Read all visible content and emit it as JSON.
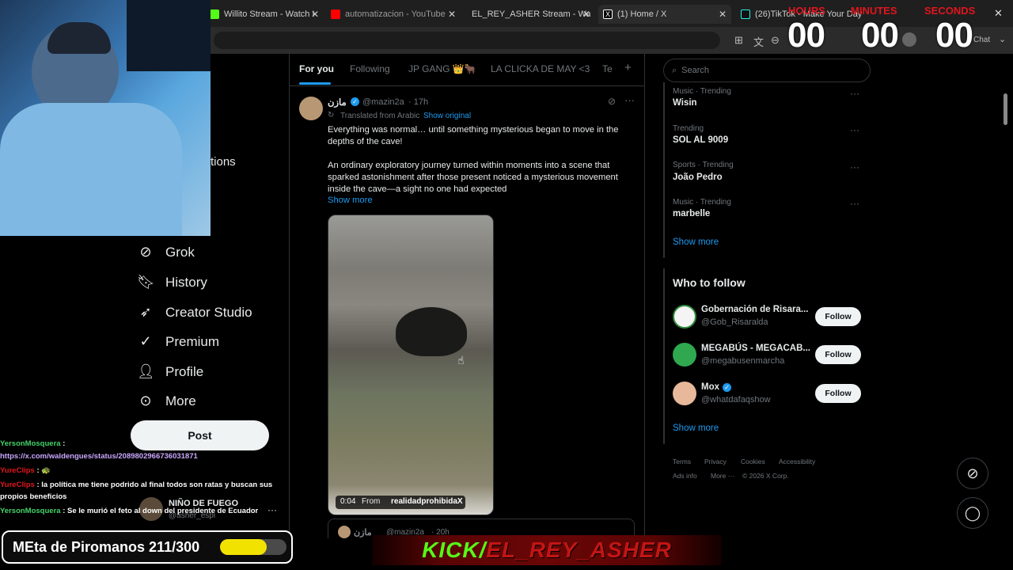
{
  "browser": {
    "tabs": [
      {
        "label": "Willito Stream - Watch I",
        "color": "#53fc18"
      },
      {
        "label": "automatizacion - YouTube",
        "color": "#ff0000"
      },
      {
        "label": "EL_REY_ASHER Stream - Watc",
        "color": "#53fc18"
      },
      {
        "label": "(1) Home / X",
        "color": "#ffffff"
      },
      {
        "label": "(26)TikTok - Make Your Day",
        "color": "#ffffff"
      }
    ],
    "chat_label": "Chat"
  },
  "timer": {
    "hours_label": "HOURS",
    "minutes_label": "MINUTES",
    "seconds_label": "SECONDS",
    "hours": "00",
    "minutes": "00",
    "seconds": "00"
  },
  "sidebar": {
    "partial_label": "tions",
    "items": [
      {
        "label": "Grok",
        "icon": "grok-icon"
      },
      {
        "label": "History",
        "icon": "bookmark-icon"
      },
      {
        "label": "Creator Studio",
        "icon": "rocket-icon"
      },
      {
        "label": "Premium",
        "icon": "verified-icon"
      },
      {
        "label": "Profile",
        "icon": "user-icon"
      },
      {
        "label": "More",
        "icon": "more-circle-icon"
      }
    ],
    "post_label": "Post",
    "account": {
      "name": "NIÑO DE FUEGO",
      "handle": "@asher_espi"
    }
  },
  "feed": {
    "tabs": [
      "For you",
      "Following",
      "JP GANG 👑🐂",
      "LA CLICKA DE MAY <3",
      "Te"
    ],
    "tweet": {
      "author": "مازن",
      "handle": "@mazin2a",
      "time": "· 17h",
      "translated": "Translated from Arabic",
      "show_original": "Show original",
      "para1": "Everything was normal… until something mysterious began to move in the depths of the cave!",
      "para2": "An ordinary exploratory journey turned within moments into a scene that sparked astonishment after those present noticed a mysterious movement inside the cave—a sight no one had expected",
      "show_more": "Show more",
      "video_time": "0:04",
      "video_from": "From",
      "video_source": "realidadprohibidaX"
    },
    "next_tweet": {
      "author": "مازن",
      "handle": "@mazin2a",
      "time": "· 20h"
    }
  },
  "right": {
    "search_placeholder": "Search",
    "trends": [
      {
        "category": "Music · Trending",
        "name": "Wisin"
      },
      {
        "category": "Trending",
        "name": "SOL AL 9009"
      },
      {
        "category": "Sports · Trending",
        "name": "João Pedro"
      },
      {
        "category": "Music · Trending",
        "name": "marbelle"
      }
    ],
    "show_more": "Show more",
    "who_to_follow_title": "Who to follow",
    "who_to_follow": [
      {
        "name": "Gobernación de Risara...",
        "handle": "@Gob_Risaralda",
        "button": "Follow"
      },
      {
        "name": "MEGABÚS - MEGACAB...",
        "handle": "@megabusenmarcha",
        "button": "Follow"
      },
      {
        "name": "Mox",
        "handle": "@whatdafaqshow",
        "button": "Follow"
      }
    ],
    "footer_row1": [
      "Terms",
      "Privacy",
      "Cookies",
      "Accessibility"
    ],
    "footer_row2": [
      "Ads info",
      "More ···",
      "© 2026 X Corp."
    ]
  },
  "chat": [
    {
      "user": "YersonMosquera",
      "text": ":"
    },
    {
      "user": "",
      "text": "https://x.com/waldengues/status/2089802966736031871"
    },
    {
      "user": "YureClips",
      "text": ": 🐢"
    },
    {
      "user": "YureClips",
      "text": ": la política me tiene podrido al final todos son ratas y buscan sus"
    },
    {
      "user": "",
      "text": "propios beneficios"
    },
    {
      "user": "YersonMosquera",
      "text": ": Se le murió el feto al down del presidente de Ecuador"
    }
  ],
  "overlay": {
    "meta_label": "MEta de Piromanos 211/300",
    "meta_progress": 0.703,
    "kick_text": "KICK/",
    "kick_channel": "EL_REY_ASHER"
  }
}
